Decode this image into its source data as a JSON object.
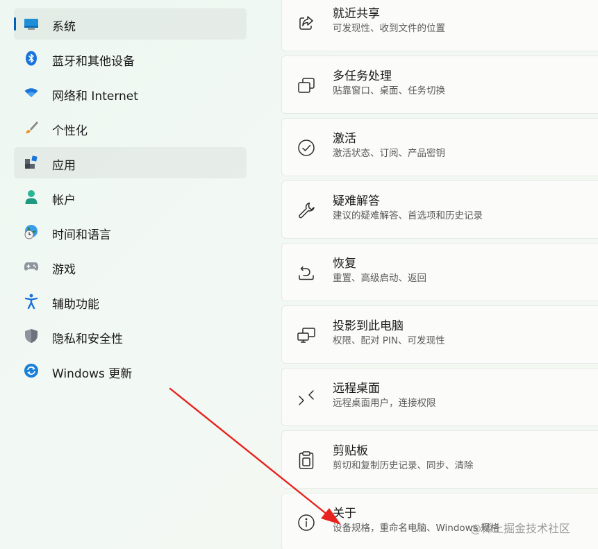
{
  "sidebar": {
    "items": [
      {
        "label": "系统",
        "icon": "monitor-icon"
      },
      {
        "label": "蓝牙和其他设备",
        "icon": "bluetooth-icon"
      },
      {
        "label": "网络和 Internet",
        "icon": "wifi-icon"
      },
      {
        "label": "个性化",
        "icon": "paintbrush-icon"
      },
      {
        "label": "应用",
        "icon": "apps-icon"
      },
      {
        "label": "帐户",
        "icon": "account-icon"
      },
      {
        "label": "时间和语言",
        "icon": "globe-clock-icon"
      },
      {
        "label": "游戏",
        "icon": "gamepad-icon"
      },
      {
        "label": "辅助功能",
        "icon": "accessibility-icon"
      },
      {
        "label": "隐私和安全性",
        "icon": "shield-icon"
      },
      {
        "label": "Windows 更新",
        "icon": "update-icon"
      }
    ]
  },
  "cards": [
    {
      "title": "就近共享",
      "subtitle": "可发现性、收到文件的位置",
      "icon": "share-icon"
    },
    {
      "title": "多任务处理",
      "subtitle": "贴靠窗口、桌面、任务切换",
      "icon": "multitask-icon"
    },
    {
      "title": "激活",
      "subtitle": "激活状态、订阅、产品密钥",
      "icon": "check-circle-icon"
    },
    {
      "title": "疑难解答",
      "subtitle": "建议的疑难解答、首选项和历史记录",
      "icon": "wrench-icon"
    },
    {
      "title": "恢复",
      "subtitle": "重置、高级启动、返回",
      "icon": "recovery-icon"
    },
    {
      "title": "投影到此电脑",
      "subtitle": "权限、配对 PIN、可发现性",
      "icon": "project-icon"
    },
    {
      "title": "远程桌面",
      "subtitle": "远程桌面用户，连接权限",
      "icon": "remote-desktop-icon"
    },
    {
      "title": "剪贴板",
      "subtitle": "剪切和复制历史记录、同步、清除",
      "icon": "clipboard-icon"
    },
    {
      "title": "关于",
      "subtitle": "设备规格，重命名电脑、Windows 规格",
      "icon": "info-icon"
    }
  ],
  "watermark": "@稀土掘金技术社区",
  "colors": {
    "accent": "#005fb8",
    "arrow": "#e8231f"
  }
}
